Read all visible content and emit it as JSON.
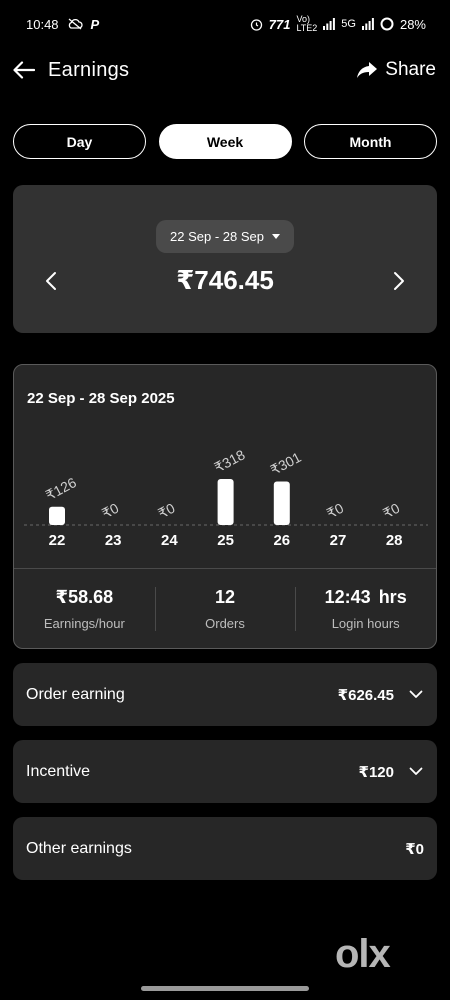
{
  "status_bar": {
    "time": "10:48",
    "battery": "28%",
    "network": "5G"
  },
  "header": {
    "title": "Earnings",
    "share_label": "Share"
  },
  "tabs": [
    {
      "label": "Day",
      "active": false
    },
    {
      "label": "Week",
      "active": true
    },
    {
      "label": "Month",
      "active": false
    }
  ],
  "summary": {
    "date_range": "22 Sep - 28 Sep",
    "total": "₹746.45"
  },
  "chart_card": {
    "range_title": "22 Sep - 28 Sep 2025"
  },
  "chart_data": {
    "type": "bar",
    "categories": [
      "22",
      "23",
      "24",
      "25",
      "26",
      "27",
      "28"
    ],
    "values": [
      126,
      0,
      0,
      318,
      301,
      0,
      0
    ],
    "value_labels": [
      "₹126",
      "₹0",
      "₹0",
      "₹318",
      "₹301",
      "₹0",
      "₹0"
    ],
    "title": "",
    "xlabel": "",
    "ylabel": "",
    "ylim": [
      0,
      318
    ],
    "bar_color": "#ffffff"
  },
  "stats": [
    {
      "value": "₹58.68",
      "unit": "",
      "label": "Earnings/hour"
    },
    {
      "value": "12",
      "unit": "",
      "label": "Orders"
    },
    {
      "value": "12:43",
      "unit": "hrs",
      "label": "Login hours"
    }
  ],
  "breakdown": [
    {
      "label": "Order earning",
      "amount": "₹626.45",
      "expandable": true
    },
    {
      "label": "Incentive",
      "amount": "₹120",
      "expandable": true
    },
    {
      "label": "Other earnings",
      "amount": "₹0",
      "expandable": false
    }
  ],
  "watermark": "OLX",
  "colors": {
    "background": "#000000",
    "card": "#323232",
    "card_dark": "#272727",
    "accent": "#ffffff"
  }
}
